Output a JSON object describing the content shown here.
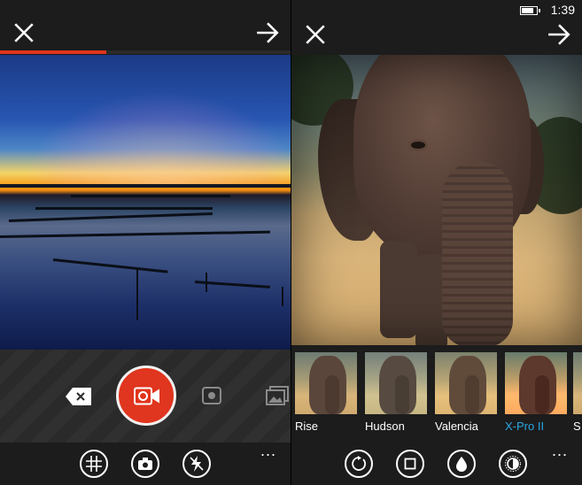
{
  "status_bar": {
    "time": "1:39",
    "battery_icon": "battery-icon"
  },
  "left_screen": {
    "top_bar": {
      "close_icon": "close-icon",
      "next_icon": "arrow-right-icon"
    },
    "recording_progress": 0.365,
    "progress_color": "#e0351e",
    "capture_controls": {
      "delete_icon": "backspace-icon",
      "record_icon": "video-camera-icon",
      "snapshot_icon": "camera-snap-icon",
      "gallery_icon": "gallery-icon",
      "record_color": "#e0351e"
    },
    "app_bar": {
      "grid_icon": "grid-icon",
      "switch_camera_icon": "switch-camera-icon",
      "flash_icon": "flash-off-icon",
      "more": "..."
    }
  },
  "right_screen": {
    "top_bar": {
      "close_icon": "close-icon",
      "next_icon": "arrow-right-icon"
    },
    "filters": [
      {
        "label": "Rise",
        "selected": false
      },
      {
        "label": "Hudson",
        "selected": false
      },
      {
        "label": "Valencia",
        "selected": false
      },
      {
        "label": "X-Pro II",
        "selected": true
      },
      {
        "label": "S",
        "selected": false
      }
    ],
    "selected_color": "#2aa7e2",
    "app_bar": {
      "rotate_icon": "rotate-icon",
      "crop_icon": "square-crop-icon",
      "drop_icon": "drop-icon",
      "brightness_icon": "brightness-icon",
      "more": "..."
    }
  }
}
